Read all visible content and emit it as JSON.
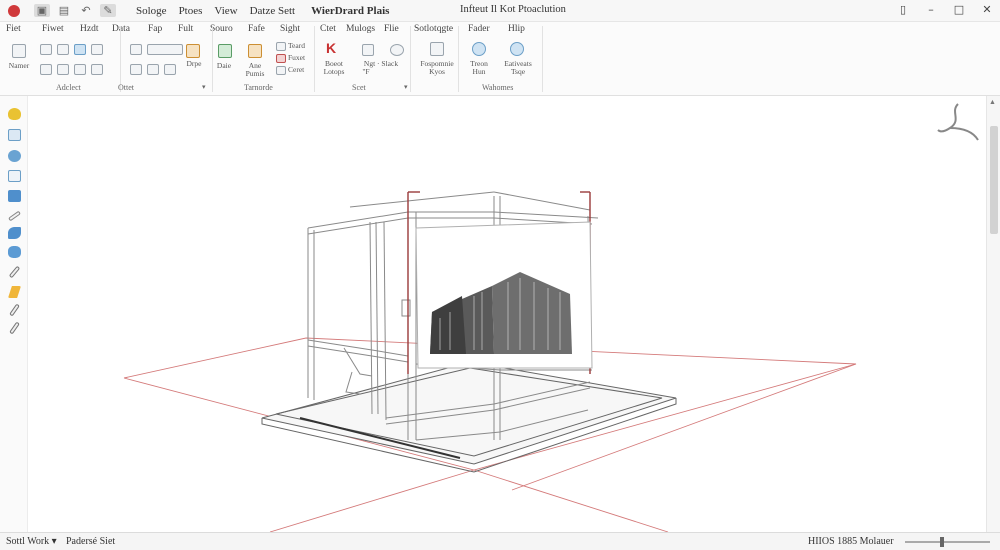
{
  "titlebar": {
    "menu": [
      "Sologe",
      "Ptoes",
      "View",
      "Datze Sett"
    ],
    "menu_title": "WierDrard Plais",
    "doc_title": "Infteut Il Kot Ptoaclution",
    "window_controls": [
      "minimize-icon",
      "maximize-icon",
      "close-icon"
    ]
  },
  "ribbon": {
    "tabs": [
      "Fiet",
      "Fiwet",
      "Hzdt",
      "Data",
      "Fap",
      "Fult",
      "Souro",
      "Fafe",
      "Sight",
      "Ctet",
      "Mulogs",
      "Flie",
      "Sotlotqgte",
      "Fader",
      "Hlip"
    ],
    "labels": {
      "nomer": "Namer",
      "drpe": "Drpe",
      "daie": "Daie",
      "ane_pumis": "Ane Pumis",
      "teard": "Teard",
      "fuxet": "Fuxet",
      "ceret": "Ceret",
      "boeot_lotops": "Boeot Lotops",
      "ngt_slack": "Ngt · Slack",
      "ngt_sub": "\"F",
      "forpome_kyos": "Fospomnie Kyos",
      "treon_hun": "Treon Hun",
      "eativeats_tsqe": "Eativeats Tsqe"
    },
    "group_labels": [
      "Adclect",
      "Ottet",
      "Tarnorde",
      "Scet",
      "Wahomes"
    ]
  },
  "left_tools": [
    "lightbulb-icon",
    "select-icon",
    "rotate-icon",
    "copy-icon",
    "layers-icon",
    "pen-icon",
    "move-icon",
    "paint-icon",
    "link-icon",
    "pencil-icon",
    "brush-icon",
    "measure-icon"
  ],
  "status": {
    "left": "Sottl Work ▾",
    "mid": "Padersé Siet",
    "right": "HIIOS 1885 Molauer"
  },
  "colors": {
    "accent_red": "#c83232",
    "model_line": "#888888",
    "guide_red": "#d47a7a"
  }
}
